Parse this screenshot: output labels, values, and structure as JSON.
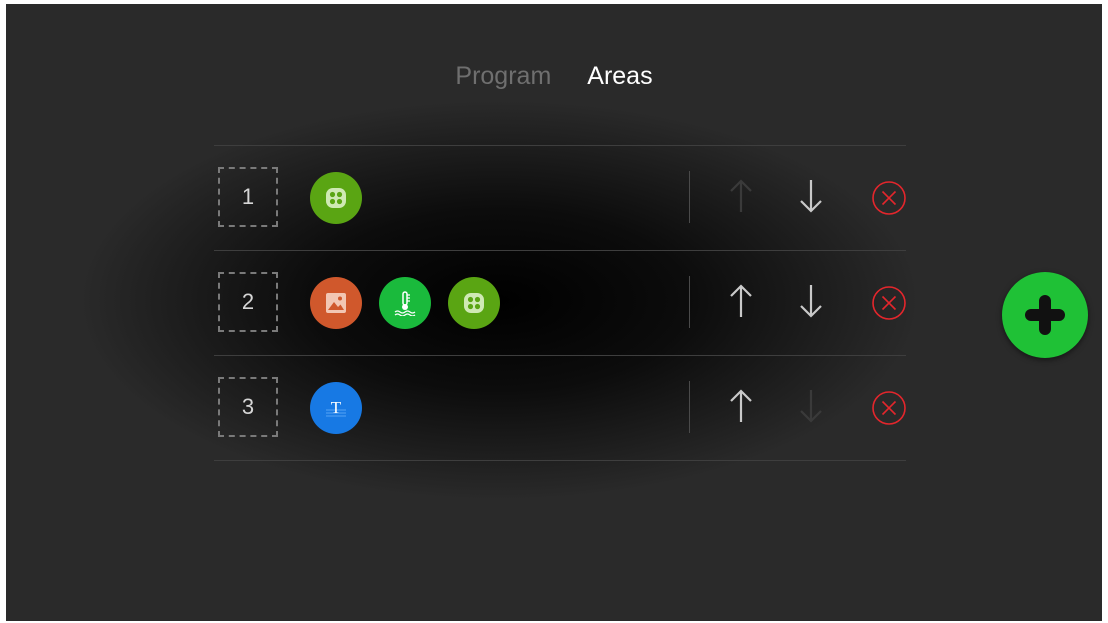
{
  "tabs": [
    {
      "label": "Program",
      "active": false
    },
    {
      "label": "Areas",
      "active": true
    }
  ],
  "areas": [
    {
      "number": "1",
      "items": [
        {
          "icon": "grid-widget-icon",
          "color": "#5aa513"
        }
      ],
      "move_up_enabled": false,
      "move_down_enabled": true
    },
    {
      "number": "2",
      "items": [
        {
          "icon": "image-icon",
          "color": "#d0582c"
        },
        {
          "icon": "thermometer-icon",
          "color": "#1aba3c"
        },
        {
          "icon": "grid-widget-icon",
          "color": "#5aa513"
        }
      ],
      "move_up_enabled": true,
      "move_down_enabled": true
    },
    {
      "number": "3",
      "items": [
        {
          "icon": "text-icon",
          "color": "#1779e4",
          "glyph": "T"
        }
      ],
      "move_up_enabled": true,
      "move_down_enabled": false
    }
  ],
  "colors": {
    "accent_green": "#1fc136",
    "delete_red": "#e4262c",
    "arrow_enabled": "#c9c9c9",
    "arrow_disabled": "#3a3a3a"
  },
  "add_button": {
    "icon": "plus-icon"
  }
}
